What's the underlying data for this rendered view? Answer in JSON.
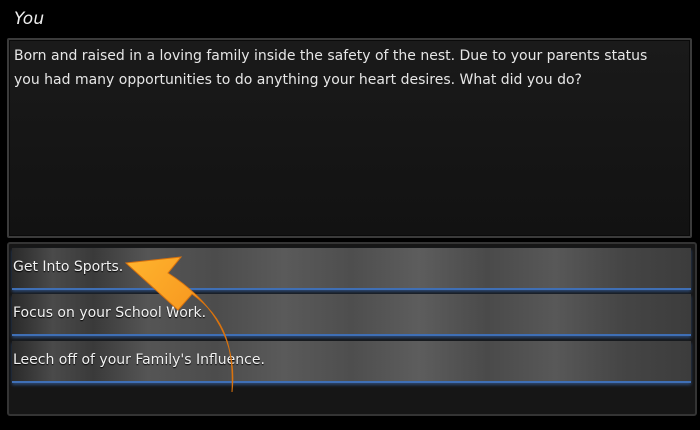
{
  "dialog": {
    "speaker": "You",
    "text": "Born and raised in a loving family inside the safety of the nest. Due to your parents status you had many opportunities to do anything your heart desires. What did you do?"
  },
  "choices": [
    {
      "label": "Get Into Sports."
    },
    {
      "label": "Focus on your School Work."
    },
    {
      "label": "Leech off of your Family's Influence."
    }
  ],
  "colors": {
    "choice_underline": "#3f6fb5",
    "annotation_arrow": "#f59a1b"
  },
  "annotation": {
    "icon": "curved-arrow-icon"
  }
}
